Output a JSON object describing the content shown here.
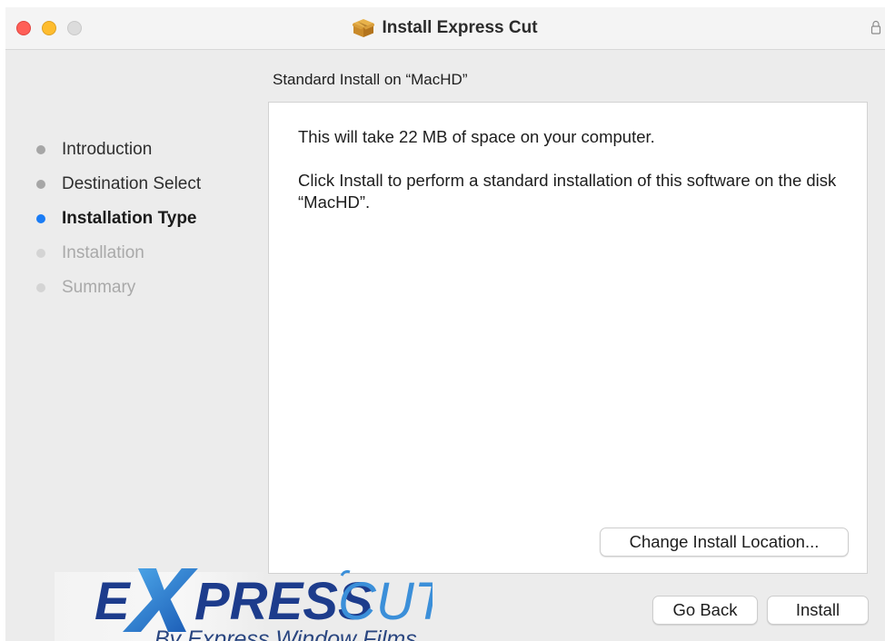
{
  "window": {
    "title": "Install Express Cut"
  },
  "pane": {
    "header": "Standard Install on “MacHD”"
  },
  "steps": [
    {
      "label": "Introduction",
      "state": "done"
    },
    {
      "label": "Destination Select",
      "state": "done"
    },
    {
      "label": "Installation Type",
      "state": "current"
    },
    {
      "label": "Installation",
      "state": "pending"
    },
    {
      "label": "Summary",
      "state": "pending"
    }
  ],
  "content": {
    "space_message": "This will take 22 MB of space on your computer.",
    "install_message": "Click Install to perform a standard installation of this software on the disk “MacHD”."
  },
  "buttons": {
    "change_location": "Change Install Location...",
    "go_back": "Go Back",
    "install": "Install"
  },
  "logo": {
    "word_express": "EXPRESS",
    "word_cut": "CUT",
    "tagline": "By Express Window Films"
  },
  "icons": {
    "title": "package-icon",
    "lock": "lock-icon"
  },
  "colors": {
    "current_step": "#1a7cf5",
    "close": "#ff5f57",
    "minimize": "#febc2e",
    "logo_navy": "#1d3c8c",
    "logo_blue": "#3b8fd9"
  }
}
